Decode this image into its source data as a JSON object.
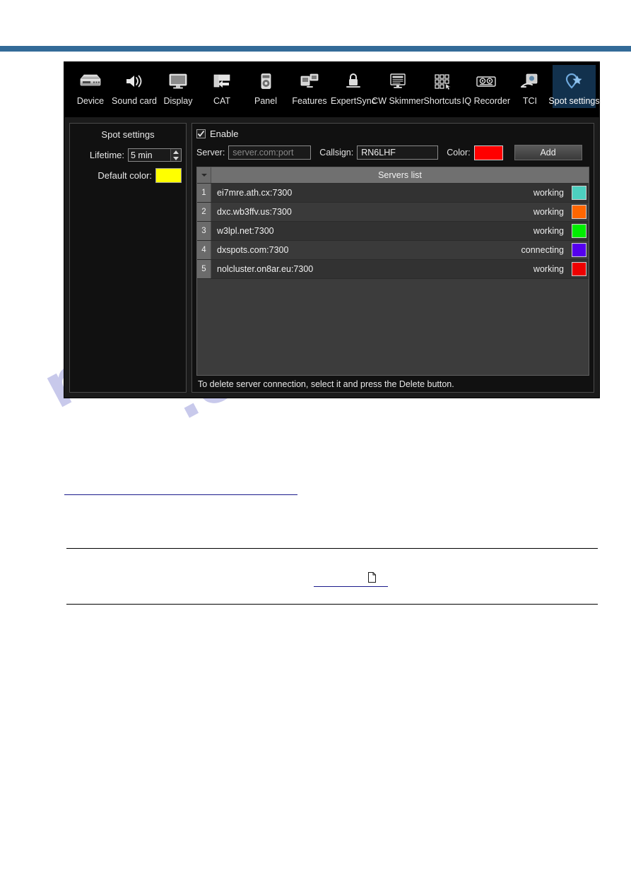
{
  "document": {
    "band_color": "#336b98",
    "watermark_line1": "manualshive",
    "watermark_line2": ".com",
    "page_glyph": "document-page-icon"
  },
  "toolbar": {
    "items": [
      {
        "label": "Device",
        "icon": "device-icon",
        "selected": false
      },
      {
        "label": "Sound card",
        "icon": "speaker-icon",
        "selected": false
      },
      {
        "label": "Display",
        "icon": "monitor-icon",
        "selected": false
      },
      {
        "label": "CAT",
        "icon": "cat-icon",
        "selected": false
      },
      {
        "label": "Panel",
        "icon": "panel-icon",
        "selected": false
      },
      {
        "label": "Features",
        "icon": "features-icon",
        "selected": false
      },
      {
        "label": "ExpertSync",
        "icon": "lock-icon",
        "selected": false
      },
      {
        "label": "CW Skimmer",
        "icon": "cw-skimmer-icon",
        "selected": false
      },
      {
        "label": "Shortcuts",
        "icon": "shortcuts-icon",
        "selected": false
      },
      {
        "label": "IQ Recorder",
        "icon": "iq-recorder-icon",
        "selected": false
      },
      {
        "label": "TCI",
        "icon": "tci-icon",
        "selected": false
      },
      {
        "label": "Spot settings",
        "icon": "map-pin-star-icon",
        "selected": true
      }
    ],
    "selected_bg": "#12314d"
  },
  "left_panel": {
    "title": "Spot settings",
    "lifetime_label": "Lifetime:",
    "lifetime_value": "5 min",
    "default_color_label": "Default color:",
    "default_color": "#FFFF00"
  },
  "right_panel": {
    "enable_label": "Enable",
    "enable_checked": true,
    "server_label": "Server:",
    "server_value": "",
    "server_placeholder": "server.com:port",
    "callsign_label": "Callsign:",
    "callsign_value": "RN6LHF",
    "color_label": "Color:",
    "color_value": "#FF0000",
    "add_label": "Add",
    "hint": "To delete server connection, select it and press the Delete button.",
    "table": {
      "header_title": "Servers list",
      "rows": [
        {
          "index": "1",
          "server": "ei7mre.ath.cx:7300",
          "status": "working",
          "color": "#4DCFBF"
        },
        {
          "index": "2",
          "server": "dxc.wb3ffv.us:7300",
          "status": "working",
          "color": "#FF6600"
        },
        {
          "index": "3",
          "server": "w3lpl.net:7300",
          "status": "working",
          "color": "#00EE00"
        },
        {
          "index": "4",
          "server": "dxspots.com:7300",
          "status": "connecting",
          "color": "#5500EE"
        },
        {
          "index": "5",
          "server": "nolcluster.on8ar.eu:7300",
          "status": "working",
          "color": "#EE0000"
        }
      ]
    }
  }
}
